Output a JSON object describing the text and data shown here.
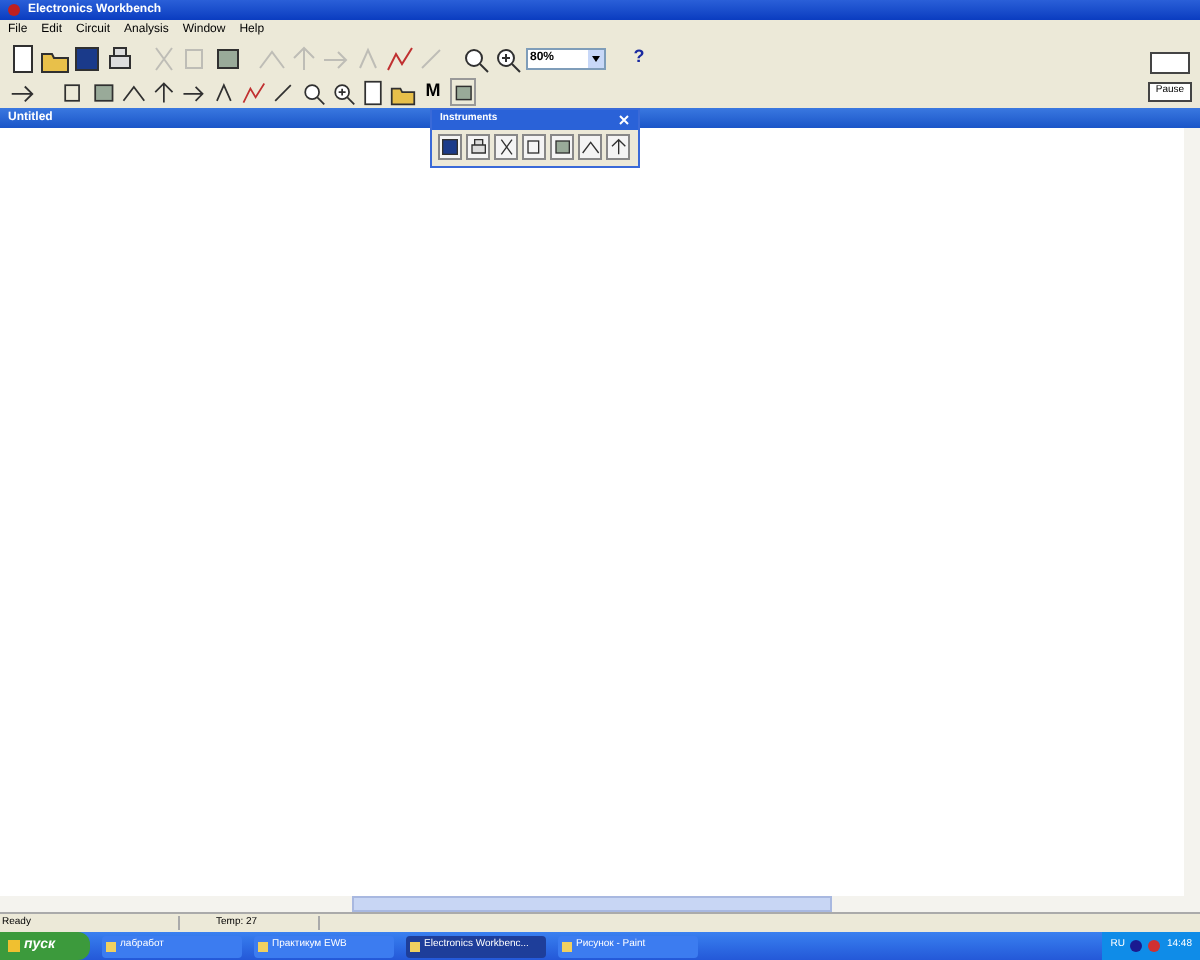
{
  "window": {
    "title": "Electronics Workbench"
  },
  "menu": [
    "File",
    "Edit",
    "Circuit",
    "Analysis",
    "Window",
    "Help"
  ],
  "toolbar": [
    {
      "disabled": false
    },
    {
      "disabled": false
    },
    {
      "disabled": false
    },
    {
      "disabled": false
    },
    {
      "disabled": true
    },
    {
      "disabled": true
    },
    {
      "disabled": false
    },
    {
      "disabled": true
    },
    {
      "disabled": true
    },
    {
      "disabled": true
    },
    {
      "disabled": true
    },
    {
      "disabled": false
    },
    {
      "disabled": true
    },
    {
      "disabled": false
    },
    {
      "disabled": false
    }
  ],
  "zoom": {
    "value": "80%"
  },
  "help": "?",
  "parts_bin_m": "M",
  "power_switch": {
    "on": false
  },
  "pause": "Pause",
  "document": {
    "title": "Untitled"
  },
  "instruments": {
    "title": "Instruments"
  },
  "status_bar": [
    "Ready",
    "Temp: 27"
  ],
  "taskbar": {
    "start": "пуск",
    "tasks": [
      {
        "label": "лабработ",
        "selected": false
      },
      {
        "label": "Практикум EWB",
        "selected": false
      },
      {
        "label": "Electronics Workbenc...",
        "selected": true
      },
      {
        "label": "Рисунок - Paint",
        "selected": false
      }
    ],
    "lang": "RU",
    "clock": "14:48"
  }
}
